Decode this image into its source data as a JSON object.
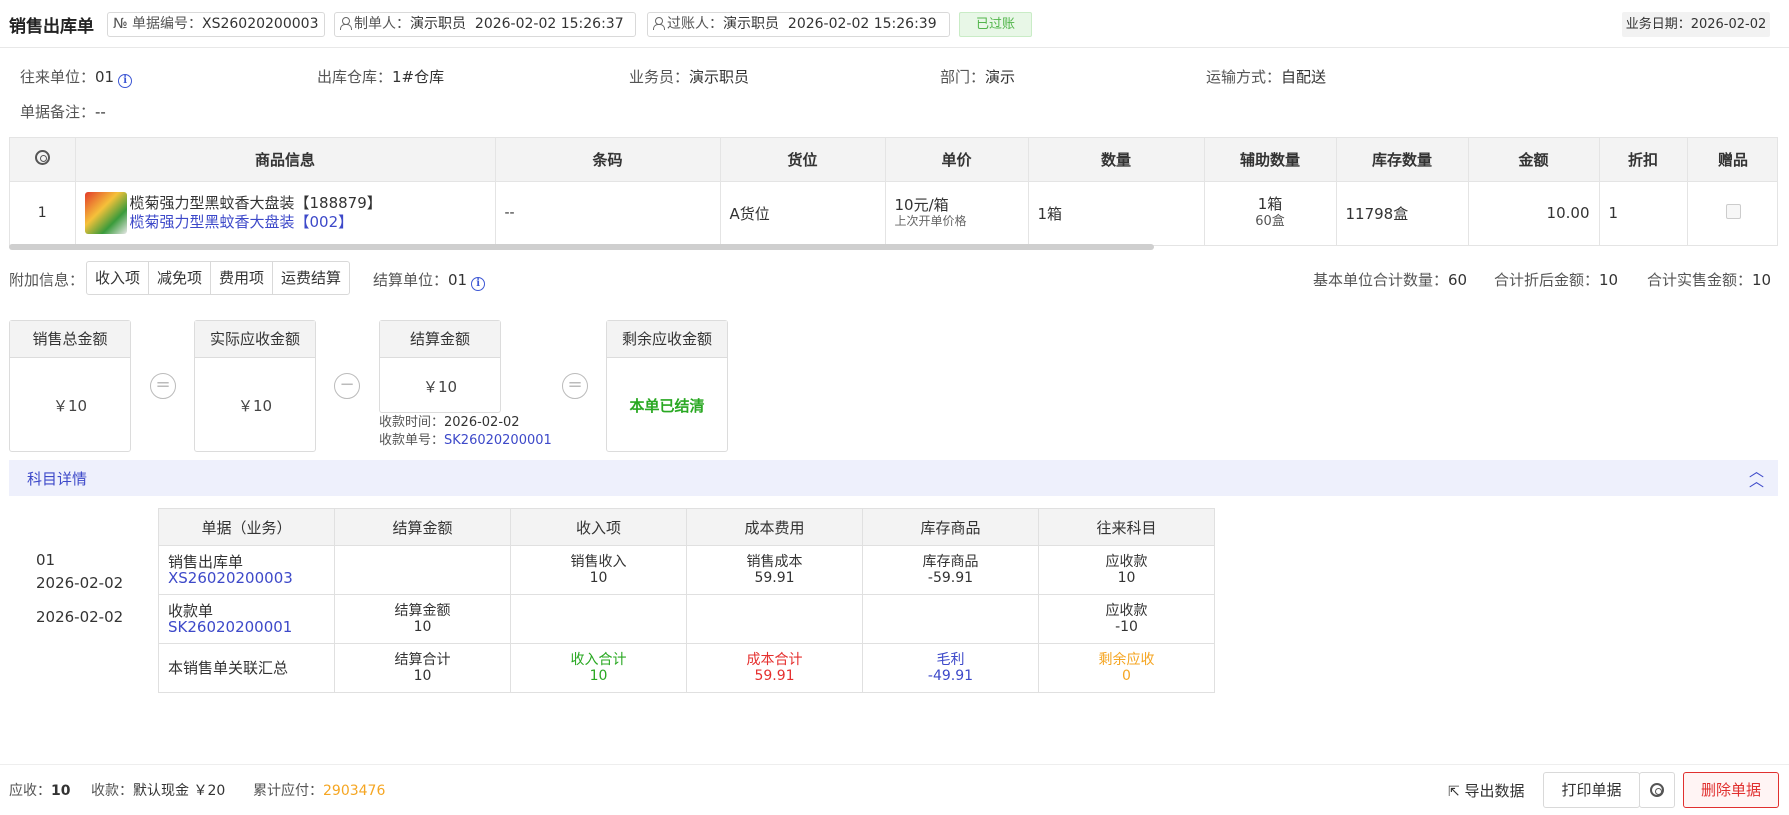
{
  "header": {
    "title": "销售出库单",
    "doc_no_label": "№ 单据编号：",
    "doc_no": "XS26020200003",
    "maker_label": "制单人：",
    "maker": "演示职员",
    "maker_time": "2026-02-02 15:26:37",
    "poster_label": "过账人：",
    "poster": "演示职员",
    "poster_time": "2026-02-02 15:26:39",
    "status": "已过账",
    "biz_date_label": "业务日期：",
    "biz_date": "2026-02-02"
  },
  "info": {
    "partner_label": "往来单位：",
    "partner": "01",
    "warehouse_label": "出库仓库：",
    "warehouse": "1#仓库",
    "salesman_label": "业务员：",
    "salesman": "演示职员",
    "dept_label": "部门：",
    "dept": "演示",
    "transport_label": "运输方式：",
    "transport": "自配送",
    "remark_label": "单据备注：",
    "remark": "--"
  },
  "grid": {
    "columns": [
      "商品信息",
      "条码",
      "货位",
      "单价",
      "数量",
      "辅助数量",
      "库存数量",
      "金额",
      "折扣",
      "赠品"
    ],
    "row": {
      "index": "1",
      "product_name": "榄菊强力型黑蚊香大盘装【188879】",
      "product_unit_link": "榄菊强力型黑蚊香大盘装【002】",
      "barcode": "--",
      "location": "A货位",
      "price": "10元/箱",
      "price_note": "上次开单价格",
      "qty": "1箱",
      "aux_qty": "1箱",
      "aux_qty_sub": "60盒",
      "stock_qty": "11798盒",
      "amount": "10.00",
      "discount": "1"
    }
  },
  "attach": {
    "label": "附加信息：",
    "buttons": [
      "收入项",
      "减免项",
      "费用项",
      "运费结算"
    ],
    "settle_unit_label": "结算单位：",
    "settle_unit": "01",
    "base_qty_label": "基本单位合计数量：",
    "base_qty": "60",
    "disc_amt_label": "合计折后金额：",
    "disc_amt": "10",
    "sale_amt_label": "合计实售金额：",
    "sale_amt": "10"
  },
  "amounts": {
    "total_label": "销售总金额",
    "total": "￥10",
    "receivable_label": "实际应收金额",
    "receivable": "￥10",
    "settle_label": "结算金额",
    "settle": "￥10",
    "remaining_label": "剩余应收金额",
    "remaining": "本单已结清",
    "eq1": "=",
    "minus": "−",
    "eq2": "=",
    "pay_time_label": "收款时间：",
    "pay_time": "2026-02-02",
    "pay_no_label": "收款单号：",
    "pay_no": "SK26020200001"
  },
  "subject": {
    "title": "科目详情",
    "left_partner": "01",
    "left_date1": "2026-02-02",
    "left_date2": "2026-02-02",
    "headers": [
      "单据（业务）",
      "结算金额",
      "收入项",
      "成本费用",
      "库存商品",
      "往来科目"
    ],
    "row1": {
      "doc": "销售出库单",
      "doc_no": "XS26020200003",
      "income": "销售收入",
      "income_v": "10",
      "cost": "销售成本",
      "cost_v": "59.91",
      "stock": "库存商品",
      "stock_v": "-59.91",
      "acct": "应收款",
      "acct_v": "10"
    },
    "row2": {
      "doc": "收款单",
      "doc_no": "SK26020200001",
      "settle": "结算金额",
      "settle_v": "10",
      "acct": "应收款",
      "acct_v": "-10"
    },
    "row3": {
      "doc": "本销售单关联汇总",
      "settle": "结算合计",
      "settle_v": "10",
      "income": "收入合计",
      "income_v": "10",
      "cost": "成本合计",
      "cost_v": "59.91",
      "profit": "毛利",
      "profit_v": "-49.91",
      "remain": "剩余应收",
      "remain_v": "0"
    }
  },
  "footer": {
    "receivable_label": "应收：",
    "receivable": "10",
    "received_label": "收款：",
    "received": "默认现金 ￥20",
    "cumulative_label": "累计应付：",
    "cumulative": "2903476",
    "export": "导出数据",
    "print": "打印单据",
    "delete": "删除单据"
  },
  "colors": {
    "accent": "#3d49c9",
    "green": "#29a822",
    "red": "#e5302f",
    "orange": "#f5a623",
    "danger": "#e0302f"
  }
}
